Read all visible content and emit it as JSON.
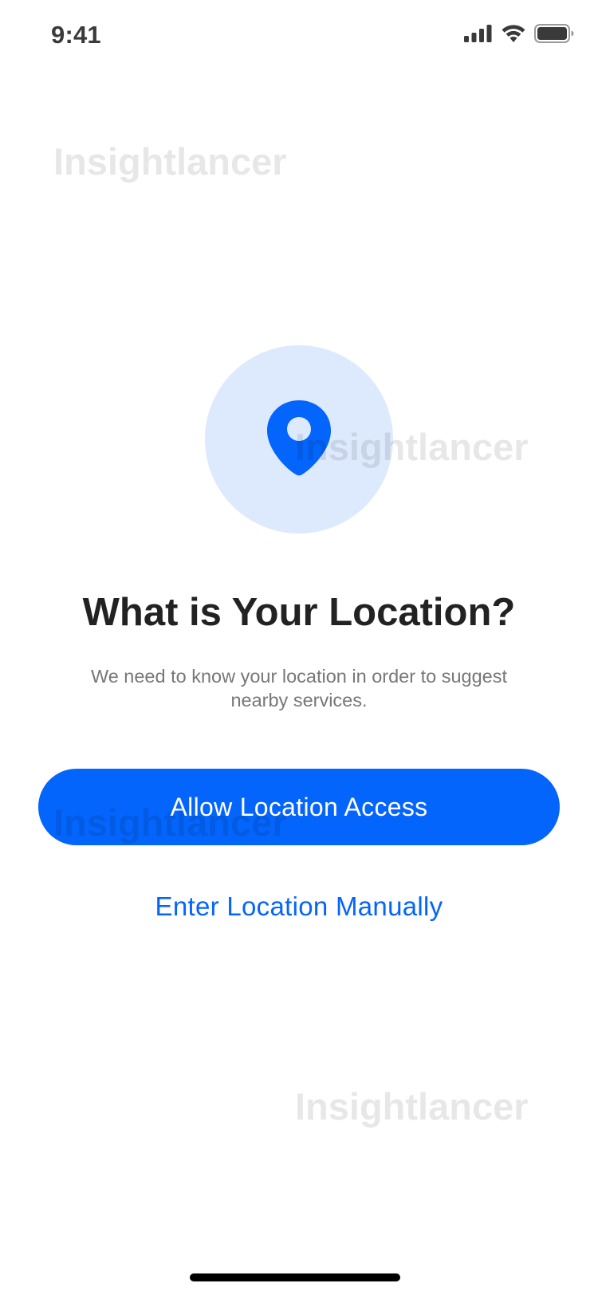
{
  "status_bar": {
    "time": "9:41",
    "icons": [
      "cellular-signal-icon",
      "wifi-icon",
      "battery-icon"
    ]
  },
  "watermark": {
    "text": "Insightlancer"
  },
  "illustration": {
    "icon": "location-pin-icon",
    "circle_color": "#dde9fd",
    "pin_color": "#0465fc"
  },
  "content": {
    "title": "What is Your Location?",
    "subtitle": "We need to know your location in order to suggest nearby services."
  },
  "actions": {
    "primary_label": "Allow Location Access",
    "secondary_label": "Enter Location Manually"
  },
  "colors": {
    "accent": "#0465fc",
    "title": "#222222",
    "subtitle": "#777777"
  }
}
